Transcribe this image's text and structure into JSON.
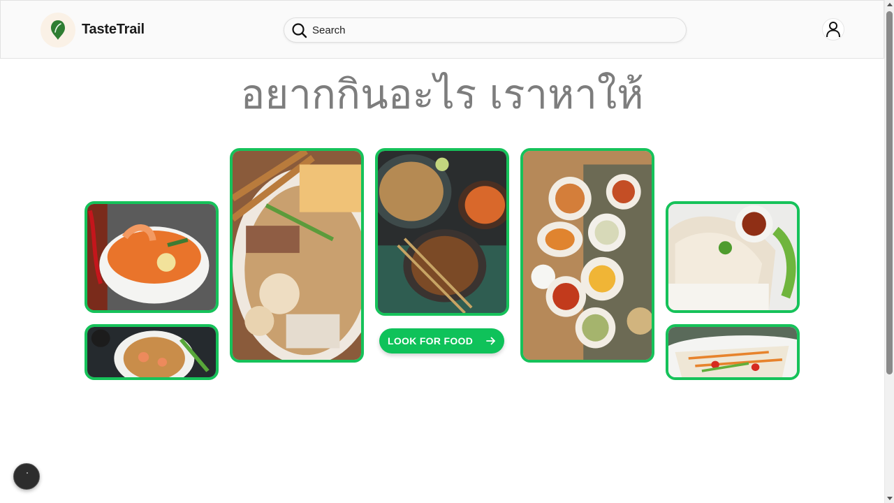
{
  "header": {
    "brand": "TasteTrail",
    "search": {
      "placeholder": "Search",
      "value": ""
    }
  },
  "hero": {
    "title": "อยากกินอะไร เราหาให้",
    "cta_label": "LOOK FOR FOOD"
  },
  "images": [
    "tom-yum-soup",
    "pad-thai",
    "noodle-bowl",
    "pad-thai-spread",
    "thai-food-spread",
    "chicken-rice",
    "som-tam"
  ],
  "colors": {
    "accent": "#16c25a",
    "title": "#7d7d7d"
  },
  "icons": [
    "leaf-pin-icon",
    "search-icon",
    "user-icon",
    "arrow-right-icon"
  ]
}
